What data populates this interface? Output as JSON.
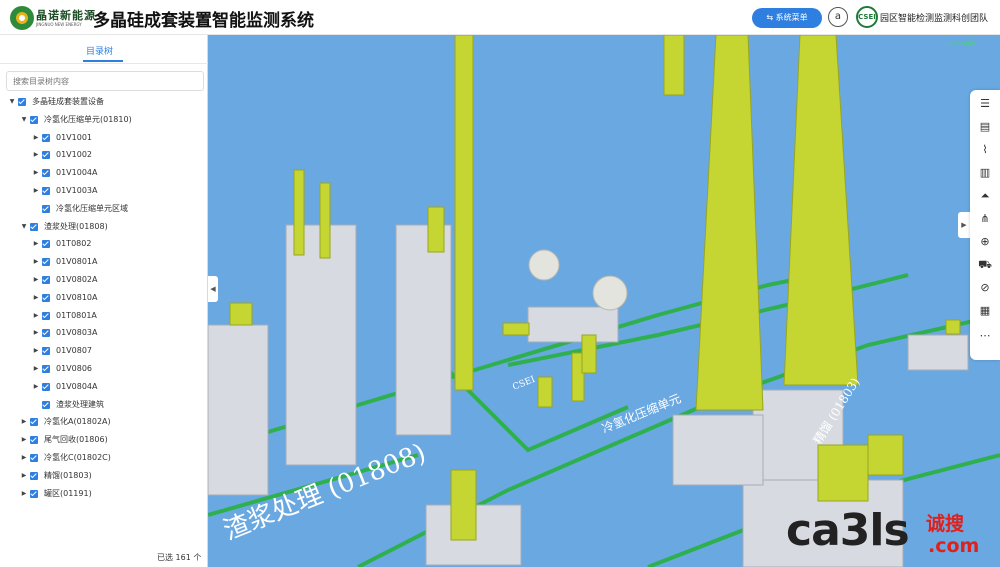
{
  "header": {
    "brand_name": "晶诺新能源",
    "brand_sub": "JINGNUO NEW ENERGY",
    "title": "多晶硅成套装置智能监测系统",
    "menu_button": "系统菜单",
    "avatar_letter": "a",
    "team_logo": "CSEI",
    "team_name": "园区智能检测监测科创团队"
  },
  "sidebar": {
    "tab": "目录树",
    "search_placeholder": "搜索目录树内容",
    "tree": [
      {
        "label": "多晶硅成套装置设备",
        "level": 0,
        "arrow": "down"
      },
      {
        "label": "冷氢化压缩单元(01810)",
        "level": 1,
        "arrow": "down"
      },
      {
        "label": "01V1001",
        "level": 2,
        "arrow": "right"
      },
      {
        "label": "01V1002",
        "level": 2,
        "arrow": "right"
      },
      {
        "label": "01V1004A",
        "level": 2,
        "arrow": "right"
      },
      {
        "label": "01V1003A",
        "level": 2,
        "arrow": "right"
      },
      {
        "label": "冷氢化压缩单元区域",
        "level": 2,
        "arrow": ""
      },
      {
        "label": "渣浆处理(01808)",
        "level": 1,
        "arrow": "down"
      },
      {
        "label": "01T0802",
        "level": 2,
        "arrow": "right"
      },
      {
        "label": "01V0801A",
        "level": 2,
        "arrow": "right"
      },
      {
        "label": "01V0802A",
        "level": 2,
        "arrow": "right"
      },
      {
        "label": "01V0810A",
        "level": 2,
        "arrow": "right"
      },
      {
        "label": "01T0801A",
        "level": 2,
        "arrow": "right"
      },
      {
        "label": "01V0803A",
        "level": 2,
        "arrow": "right"
      },
      {
        "label": "01V0807",
        "level": 2,
        "arrow": "right"
      },
      {
        "label": "01V0806",
        "level": 2,
        "arrow": "right"
      },
      {
        "label": "01V0804A",
        "level": 2,
        "arrow": "right"
      },
      {
        "label": "渣浆处理建筑",
        "level": 2,
        "arrow": ""
      },
      {
        "label": "冷氢化A(01802A)",
        "level": 1,
        "arrow": "right"
      },
      {
        "label": "尾气回收(01806)",
        "level": 1,
        "arrow": "right"
      },
      {
        "label": "冷氢化C(01802C)",
        "level": 1,
        "arrow": "right"
      },
      {
        "label": "精馏(01803)",
        "level": 1,
        "arrow": "right"
      },
      {
        "label": "罐区(01191)",
        "level": 1,
        "arrow": "right"
      }
    ],
    "selected_count": "已选 161 个"
  },
  "scene": {
    "status": "3D model",
    "ground_label_main": "渣浆处理 (01808)",
    "ground_label_mid": "冷氢化压缩单元",
    "ground_label_right": "精馏 (01803)",
    "ground_label_small": "CSEI",
    "ground_color": "#6aa8e2",
    "equipment_color": "#c5d633",
    "structure_color": "#d7dbe1",
    "marking_color": "#2fb04e"
  },
  "toolbar": [
    {
      "icon": "list-icon"
    },
    {
      "icon": "document-icon"
    },
    {
      "icon": "chart-icon"
    },
    {
      "icon": "report-icon"
    },
    {
      "icon": "alarm-icon"
    },
    {
      "icon": "network-icon"
    },
    {
      "icon": "target-icon"
    },
    {
      "icon": "vehicle-icon"
    },
    {
      "icon": "hide-icon"
    },
    {
      "icon": "grid-icon"
    },
    {
      "icon": "more-icon"
    }
  ],
  "watermark": {
    "main": "ca3ls",
    "cn": "诚搜",
    "com": ".com"
  }
}
